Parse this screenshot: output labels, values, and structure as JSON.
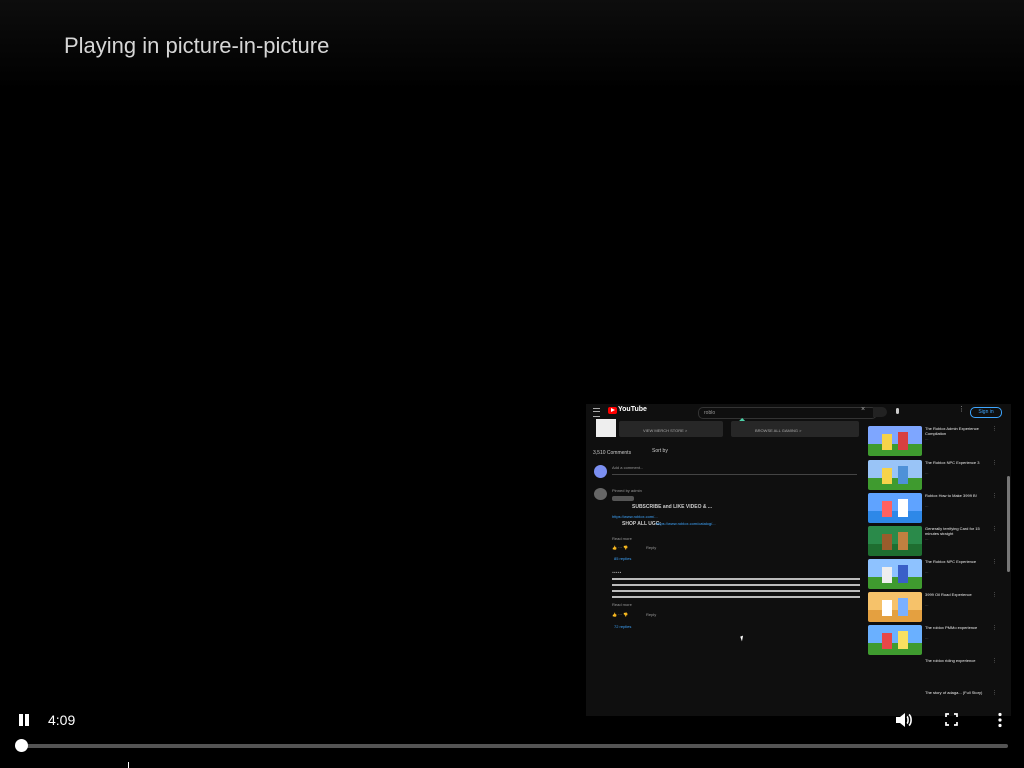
{
  "pip_message": "Playing in picture-in-picture",
  "player": {
    "time": "4:09",
    "progress": 0.0
  },
  "icons": {
    "pause": "pause-icon",
    "volume": "volume-icon",
    "fullscreen": "fullscreen-icon",
    "more": "more-vert-icon"
  },
  "pip_window": {
    "header": {
      "logo": "YouTube",
      "search_value": "roblo",
      "sign_in": "Sign in"
    },
    "cards": [
      {
        "label": "VIEW MERCH STORE >"
      },
      {
        "label": "BROWSE ALL GAMING >"
      }
    ],
    "comments_header": {
      "count": "3,510 Comments",
      "sort": "Sort by",
      "add_placeholder": "Add a comment..."
    },
    "pinned_comment": {
      "subtitle": "Pinned by admin",
      "line1": "SUBSCRIBE and LIKE VIDEO & ...",
      "line2": "SHOP ALL UGC:",
      "read_more": "Read more",
      "replies": "85 replies"
    },
    "second_comment": {
      "read_more": "Read more",
      "replies": "72 replies"
    },
    "recommendations": [
      {
        "title": "The Roblox Admin Experience Compilation"
      },
      {
        "title": "The Roblox NPC Experience 3"
      },
      {
        "title": "Roblox How to Make 3999 B!"
      },
      {
        "title": "Generally terrifying Card for 15 minutes straight"
      },
      {
        "title": "The Roblox NPC Experience"
      },
      {
        "title": "3999 Oil Road Experience"
      },
      {
        "title": "The roblox PMMo experience"
      },
      {
        "title": "The roblox riding experience"
      },
      {
        "title": "The story of adaga... (Full Story)"
      }
    ]
  }
}
